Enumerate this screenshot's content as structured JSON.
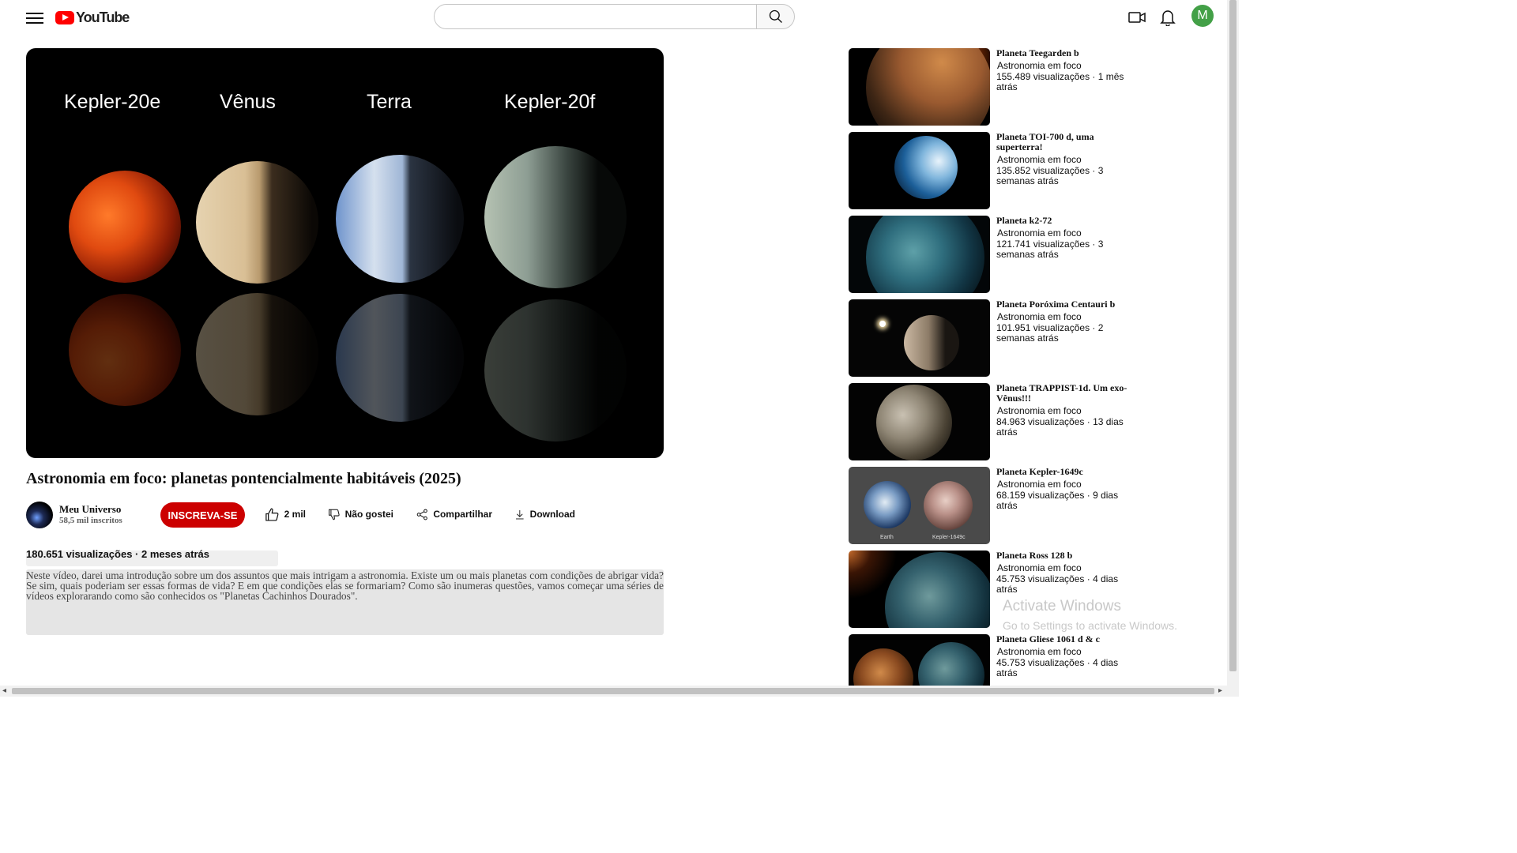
{
  "header": {
    "logo_text": "YouTube",
    "search_placeholder": "",
    "avatar_letter": "M"
  },
  "video": {
    "planet_labels": [
      "Kepler-20e",
      "Vênus",
      "Terra",
      "Kepler-20f"
    ],
    "title": "Astronomia em foco: planetas pontencialmente habitáveis (2025)",
    "channel_name": "Meu Universo",
    "channel_subs": "58,5 mil inscritos",
    "subscribe_label": "INSCREVA-SE",
    "like_label": "2 mil",
    "dislike_label": "Não gostei",
    "share_label": "Compartilhar",
    "download_label": "Download",
    "views_line": "180.651 visualizações · 2 meses atrás",
    "description": "Neste vídeo, darei uma introdução sobre um dos assuntos que mais intrigam a astronomia. Existe um ou mais planetas com condições de abrigar vida? Se sim, quais poderiam ser essas formas de vida? E em que condições elas se formariam? Como são inumeras questões, vamos começar uma séries de vídeos explorarando como são conhecidos os \"Planetas Cachinhos Dourados\"."
  },
  "recommendations": [
    {
      "title": "Planeta Teegarden b",
      "channel": "Astronomia em foco",
      "meta": "155.489 visualizações · 1 mês atrás",
      "thumb": "teegarden"
    },
    {
      "title": "Planeta TOI-700 d, uma superterra!",
      "channel": "Astronomia em foco",
      "meta": "135.852 visualizações · 3 semanas atrás",
      "thumb": "toi700"
    },
    {
      "title": "Planeta k2-72",
      "channel": "Astronomia em foco",
      "meta": "121.741 visualizações · 3 semanas atrás",
      "thumb": "k272"
    },
    {
      "title": "Planeta Poróxima Centauri b",
      "channel": "Astronomia em foco",
      "meta": "101.951 visualizações · 2 semanas atrás",
      "thumb": "proxima"
    },
    {
      "title": "Planeta TRAPPIST-1d. Um exo-Vênus!!!",
      "channel": "Astronomia em foco",
      "meta": "84.963 visualizações · 13 dias atrás",
      "thumb": "trappist"
    },
    {
      "title": "Planeta Kepler-1649c",
      "channel": "Astronomia em foco",
      "meta": "68.159 visualizações · 9 dias atrás",
      "thumb": "kepler1649",
      "thumb_labels": [
        "Earth",
        "Kepler-1649c"
      ]
    },
    {
      "title": "Planeta Ross 128 b",
      "channel": "Astronomia em foco",
      "meta": "45.753 visualizações · 4 dias atrás",
      "thumb": "ross128"
    },
    {
      "title": "Planeta Gliese 1061 d & c",
      "channel": "Astronomia em foco",
      "meta": "45.753 visualizações · 4 dias atrás",
      "thumb": "gliese"
    }
  ],
  "watermark": {
    "line1": "Activate Windows",
    "line2": "Go to Settings to activate Windows."
  }
}
